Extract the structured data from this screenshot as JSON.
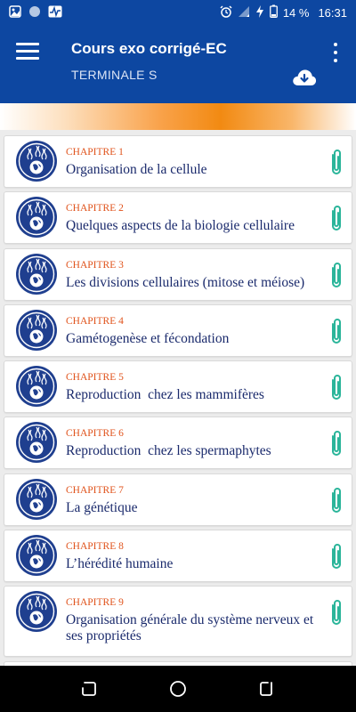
{
  "status": {
    "battery": "14 %",
    "time": "16:31"
  },
  "app_bar": {
    "title": "Cours exo corrigé-EC",
    "subtitle": "TERMINALE S"
  },
  "colors": {
    "primary": "#0d47a1",
    "accent_orange": "#e0531c",
    "title_blue": "#1a2a6c",
    "clip_teal": "#2bb59a"
  },
  "chapters": [
    {
      "label": "CHAPITRE 1",
      "title": "Organisation de la cellule"
    },
    {
      "label": "CHAPITRE 2",
      "title": "Quelques aspects de la biologie cellulaire"
    },
    {
      "label": "CHAPITRE 3",
      "title": "Les divisions cellulaires (mitose et méiose)"
    },
    {
      "label": "CHAPITRE 4",
      "title": "Gamétogenèse et fécondation"
    },
    {
      "label": "CHAPITRE 5",
      "title": "Reproduction  chez les mammifères"
    },
    {
      "label": "CHAPITRE 6",
      "title": "Reproduction  chez les spermaphytes"
    },
    {
      "label": "CHAPITRE 7",
      "title": "La génétique"
    },
    {
      "label": "CHAPITRE 8",
      "title": "L’hérédité humaine"
    },
    {
      "label": "CHAPITRE 9",
      "title": "Organisation générale du système nerveux et ses propriétés"
    }
  ],
  "icons": {
    "menu": "hamburger-icon",
    "more": "more-vert-icon",
    "download": "cloud-download-icon",
    "chapter": "biology-logo-icon",
    "attachment": "paperclip-icon"
  }
}
